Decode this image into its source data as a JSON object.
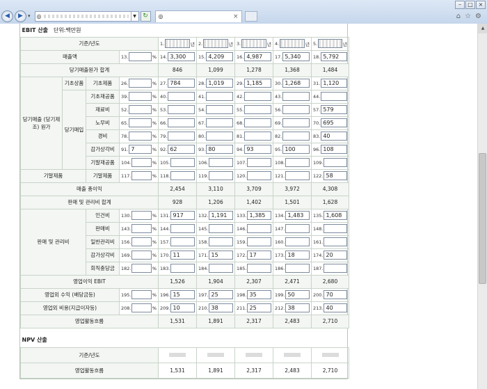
{
  "browser": {
    "win_min": "–",
    "win_max": "□",
    "win_close": "×",
    "back": "◀",
    "forward": "▶",
    "refresh": "↻",
    "tab_close": "×",
    "home_icon": "⌂",
    "star_icon": "☆",
    "gear_icon": "⚙"
  },
  "ebit": {
    "title": "EBIT 산출",
    "unit": "단위:백만원",
    "year_label": "기준/년도",
    "year_suffix": "년",
    "year_prefixes": [
      "1.",
      "2.",
      "3.",
      "4.",
      "5."
    ],
    "rows": {
      "sales": {
        "label": "매출액",
        "pct_no": "13.",
        "nos": [
          "14.",
          "15.",
          "16.",
          "17.",
          "18."
        ],
        "vals": [
          "3,300",
          "4,209",
          "4,987",
          "5,340",
          "5,792"
        ]
      },
      "cogs_total": {
        "label": "당기매출원가 합계",
        "vals": [
          "846",
          "1,099",
          "1,278",
          "1,368",
          "1,484"
        ]
      },
      "cogs_group": "당기매출 (당기제조) 원가",
      "base_stock": "기초상품",
      "base_product": {
        "label": "기초제품",
        "pct_no": "26.",
        "nos": [
          "27.",
          "28.",
          "29.",
          "30.",
          "31."
        ],
        "vals": [
          "784",
          "1,019",
          "1,185",
          "1,268",
          "1,120"
        ]
      },
      "purchase_group": "당기매입",
      "base_wip": {
        "label": "기초재공품",
        "pct_no": "39.",
        "nos": [
          "40.",
          "41.",
          "42.",
          "43.",
          "44."
        ],
        "vals": [
          "",
          "",
          "",
          "",
          ""
        ]
      },
      "materials": {
        "label": "재료비",
        "pct_no": "52.",
        "nos": [
          "53.",
          "54.",
          "55.",
          "56.",
          "57."
        ],
        "vals": [
          "",
          "",
          "",
          "",
          "579"
        ]
      },
      "labor": {
        "label": "노무비",
        "pct_no": "65.",
        "nos": [
          "66.",
          "67.",
          "68.",
          "69.",
          "70."
        ],
        "vals": [
          "",
          "",
          "",
          "",
          "695"
        ]
      },
      "expense": {
        "label": "경비",
        "pct_no": "78.",
        "nos": [
          "79.",
          "80.",
          "81.",
          "82.",
          "83."
        ],
        "vals": [
          "",
          "",
          "",
          "",
          "40"
        ]
      },
      "depreciation": {
        "label": "감가상각비",
        "pct_no": "91.",
        "pct_val": "7",
        "nos": [
          "92.",
          "93.",
          "94.",
          "95.",
          "96."
        ],
        "vals": [
          "62",
          "80",
          "93",
          "100",
          "108"
        ]
      },
      "end_wip": {
        "label": "기말재공품",
        "pct_no": "104.",
        "nos": [
          "105.",
          "106.",
          "107.",
          "108.",
          "109."
        ],
        "vals": [
          "",
          "",
          "",
          "",
          ""
        ]
      },
      "end_group": "기말제품",
      "end_product": {
        "label": "기말제품",
        "pct_no": "117.",
        "nos": [
          "118.",
          "119.",
          "120.",
          "121.",
          "122."
        ],
        "vals": [
          "",
          "",
          "",
          "",
          "58"
        ]
      },
      "gross_profit": {
        "label": "매출 총이익",
        "vals": [
          "2,454",
          "3,110",
          "3,709",
          "3,972",
          "4,308"
        ]
      },
      "sga_total": {
        "label": "판매 및 관리비 합계",
        "vals": [
          "928",
          "1,206",
          "1,402",
          "1,501",
          "1,628"
        ]
      },
      "sga_group": "판매 및 관리비",
      "personnel": {
        "label": "인건비",
        "pct_no": "130.",
        "nos": [
          "131.",
          "132.",
          "133.",
          "134.",
          "135."
        ],
        "vals": [
          "917",
          "1,191",
          "1,385",
          "1,483",
          "1,608"
        ]
      },
      "selling": {
        "label": "판매비",
        "pct_no": "143.",
        "nos": [
          "144.",
          "145.",
          "146.",
          "147.",
          "148."
        ],
        "vals": [
          "",
          "",
          "",
          "",
          ""
        ]
      },
      "general_admin": {
        "label": "일반관리비",
        "pct_no": "156.",
        "nos": [
          "157.",
          "158.",
          "159.",
          "160.",
          "161."
        ],
        "vals": [
          "",
          "",
          "",
          "",
          ""
        ]
      },
      "sga_depreciation": {
        "label": "감가상각비",
        "pct_no": "169.",
        "nos": [
          "170.",
          "171.",
          "172.",
          "173.",
          "174."
        ],
        "vals": [
          "11",
          "15",
          "17",
          "18",
          "20"
        ]
      },
      "bad_debt": {
        "label": "회직충당금",
        "pct_no": "182.",
        "nos": [
          "183.",
          "184.",
          "185.",
          "186.",
          "187."
        ],
        "vals": [
          "",
          "",
          "",
          "",
          ""
        ]
      },
      "op_income": {
        "label": "영업이익 EBIT",
        "vals": [
          "1,526",
          "1,904",
          "2,307",
          "2,471",
          "2,680"
        ]
      },
      "non_op_income": {
        "label": "영업외 수익 (배당금등)",
        "pct_no": "195.",
        "nos": [
          "196.",
          "197.",
          "198.",
          "199.",
          "200."
        ],
        "vals": [
          "15",
          "25",
          "35",
          "50",
          "70"
        ]
      },
      "non_op_expense": {
        "label": "영업외 비용(지급이자등)",
        "pct_no": "208.",
        "nos": [
          "209.",
          "210.",
          "211.",
          "212.",
          "213."
        ],
        "vals": [
          "10",
          "38",
          "25",
          "38",
          "40"
        ]
      },
      "op_cashflow": {
        "label": "영업활동흐름",
        "vals": [
          "1,531",
          "1,891",
          "2,317",
          "2,483",
          "2,710"
        ]
      }
    },
    "pct_sign": "%"
  },
  "npv": {
    "title": "NPV 산출",
    "year_label": "기준/년도",
    "cashflow_label": "영업활동흐름",
    "cashflow_vals": [
      "1,531",
      "1,891",
      "2,317",
      "2,483",
      "2,710"
    ]
  }
}
